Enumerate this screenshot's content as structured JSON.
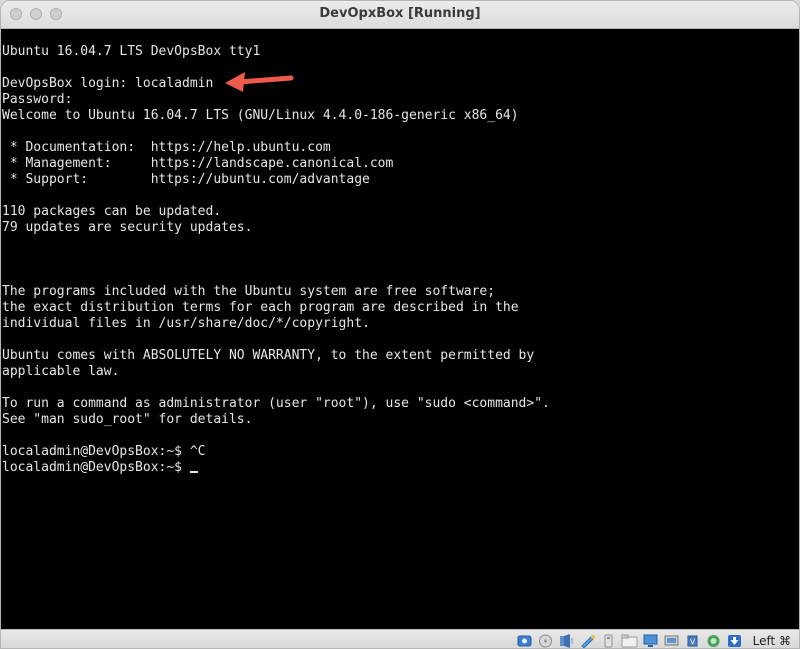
{
  "window": {
    "title": "DevOpxBox [Running]"
  },
  "terminal": {
    "lines": [
      "Ubuntu 16.04.7 LTS DevOpsBox tty1",
      "",
      "DevOpsBox login: localadmin",
      "Password:",
      "Welcome to Ubuntu 16.04.7 LTS (GNU/Linux 4.4.0-186-generic x86_64)",
      "",
      " * Documentation:  https://help.ubuntu.com",
      " * Management:     https://landscape.canonical.com",
      " * Support:        https://ubuntu.com/advantage",
      "",
      "110 packages can be updated.",
      "79 updates are security updates.",
      "",
      "",
      "",
      "The programs included with the Ubuntu system are free software;",
      "the exact distribution terms for each program are described in the",
      "individual files in /usr/share/doc/*/copyright.",
      "",
      "Ubuntu comes with ABSOLUTELY NO WARRANTY, to the extent permitted by",
      "applicable law.",
      "",
      "To run a command as administrator (user \"root\"), use \"sudo <command>\".",
      "See \"man sudo_root\" for details.",
      "",
      "localadmin@DevOpsBox:~$ ^C"
    ],
    "prompt": "localadmin@DevOpsBox:~$ "
  },
  "statusbar": {
    "host_key": "Left ⌘",
    "icons": [
      "hard-disk-icon",
      "optical-drive-icon",
      "audio-icon",
      "network-icon",
      "usb-icon",
      "shared-folders-icon",
      "display-icon",
      "video-capture-icon",
      "cpu-icon",
      "mouse-integration-icon",
      "keyboard-capture-icon"
    ]
  },
  "colors": {
    "terminal_bg": "#000000",
    "terminal_fg": "#e6e6e6",
    "arrow": "#f05a4a"
  }
}
